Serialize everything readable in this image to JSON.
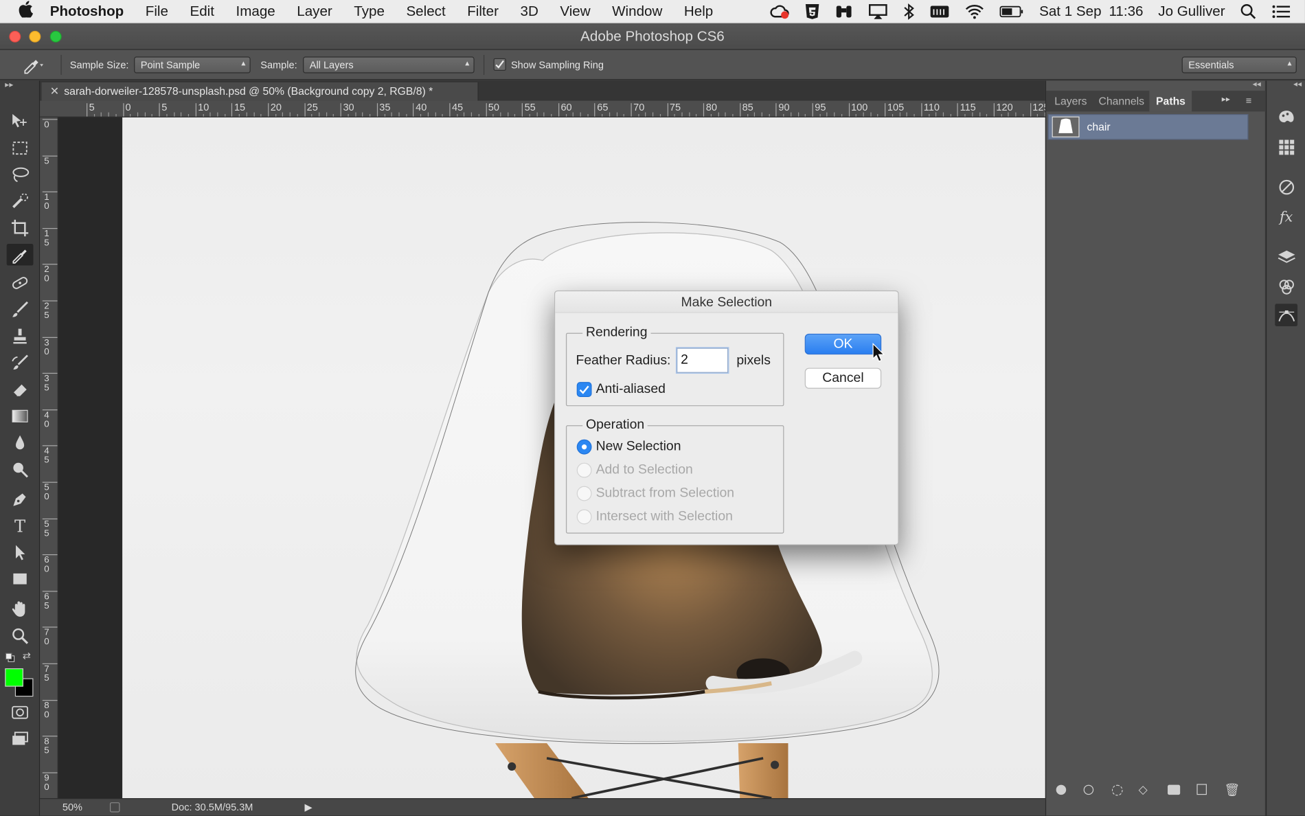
{
  "menubar": {
    "app_name": "Photoshop",
    "items": [
      "File",
      "Edit",
      "Image",
      "Layer",
      "Type",
      "Select",
      "Filter",
      "3D",
      "View",
      "Window",
      "Help"
    ],
    "date": "Sat 1 Sep",
    "time": "11:36",
    "user": "Jo Gulliver",
    "status_icons": [
      "creative-cloud-icon",
      "html5-icon",
      "binoculars-icon",
      "airplay-icon",
      "bluetooth-icon",
      "keyboard-icon",
      "wifi-icon",
      "battery-icon",
      "spotlight-search-icon",
      "notification-center-icon"
    ]
  },
  "window": {
    "title": "Adobe Photoshop CS6"
  },
  "options_bar": {
    "sample_size_label": "Sample Size:",
    "sample_size_value": "Point Sample",
    "sample_label": "Sample:",
    "sample_value": "All Layers",
    "show_sampling_ring_label": "Show Sampling Ring",
    "show_sampling_ring_checked": true,
    "workspace_value": "Essentials"
  },
  "document": {
    "tab_title": "sarah-dorweiler-128578-unsplash.psd @ 50% (Background copy 2, RGB/8) *",
    "ruler_top_labels": [
      "5",
      "0",
      "5",
      "10",
      "15",
      "20",
      "25",
      "30",
      "35",
      "40",
      "45",
      "50",
      "55",
      "60",
      "65",
      "70",
      "75",
      "80",
      "85",
      "90",
      "95",
      "100",
      "105",
      "110",
      "115",
      "120",
      "125"
    ],
    "ruler_left_labels": [
      "0",
      "5",
      "10",
      "15",
      "20",
      "25",
      "30",
      "35",
      "40",
      "45",
      "50",
      "55",
      "60",
      "65",
      "70",
      "75",
      "80",
      "85",
      "90"
    ],
    "zoom": "50%",
    "doc_size": "Doc: 30.5M/95.3M"
  },
  "panels": {
    "tabs": [
      "Layers",
      "Channels",
      "Paths"
    ],
    "active_tab": "Paths",
    "paths": [
      {
        "name": "chair"
      }
    ]
  },
  "tools": {
    "foreground_color": "#00ff00",
    "background_color": "#000000"
  },
  "dialog": {
    "title": "Make Selection",
    "rendering_label": "Rendering",
    "feather_radius_label": "Feather Radius:",
    "feather_radius_value": "2",
    "pixels_label": "pixels",
    "anti_aliased_label": "Anti-aliased",
    "anti_aliased_checked": true,
    "operation_label": "Operation",
    "operations": [
      {
        "label": "New Selection",
        "selected": true,
        "enabled": true
      },
      {
        "label": "Add to Selection",
        "selected": false,
        "enabled": false
      },
      {
        "label": "Subtract from Selection",
        "selected": false,
        "enabled": false
      },
      {
        "label": "Intersect with Selection",
        "selected": false,
        "enabled": false
      }
    ],
    "ok_label": "OK",
    "cancel_label": "Cancel"
  },
  "colors": {
    "accent": "#2b87f2",
    "path_selected": "#6b7a95"
  }
}
